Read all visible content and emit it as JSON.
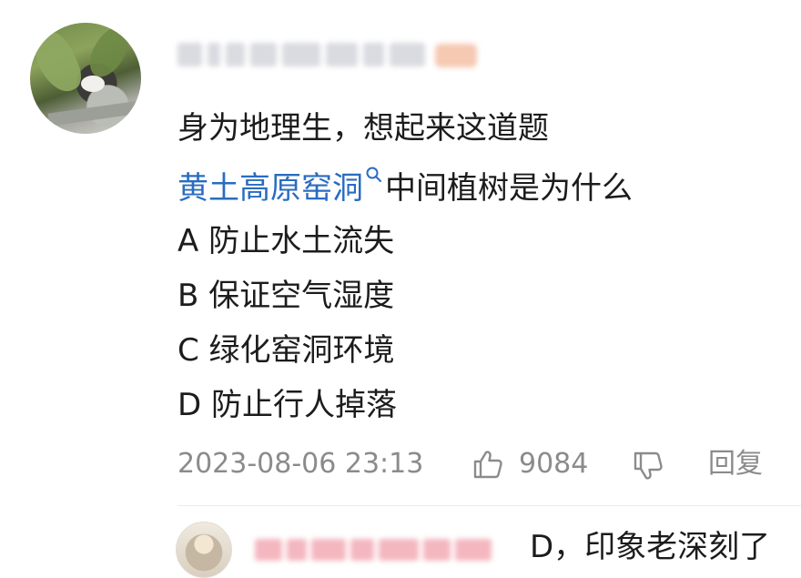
{
  "comment": {
    "line1": "身为地理生，想起来这道题",
    "topic_link": "黄土高原窑洞",
    "question_rest": "中间植树是为什么",
    "options": [
      "A 防止水土流失",
      "B 保证空气湿度",
      "C 绿化窑洞环境",
      "D 防止行人掉落"
    ],
    "timestamp": "2023-08-06 23:13",
    "like_count": "9084",
    "reply_label": "回复"
  },
  "reply": {
    "text": "D，印象老深刻了"
  },
  "icons": {
    "search": "search-icon",
    "like": "thumbs-up-icon",
    "dislike": "thumbs-down-icon"
  },
  "colors": {
    "link": "#2a6cc0",
    "meta": "#8b8b8b",
    "text": "#1c1c1c"
  }
}
